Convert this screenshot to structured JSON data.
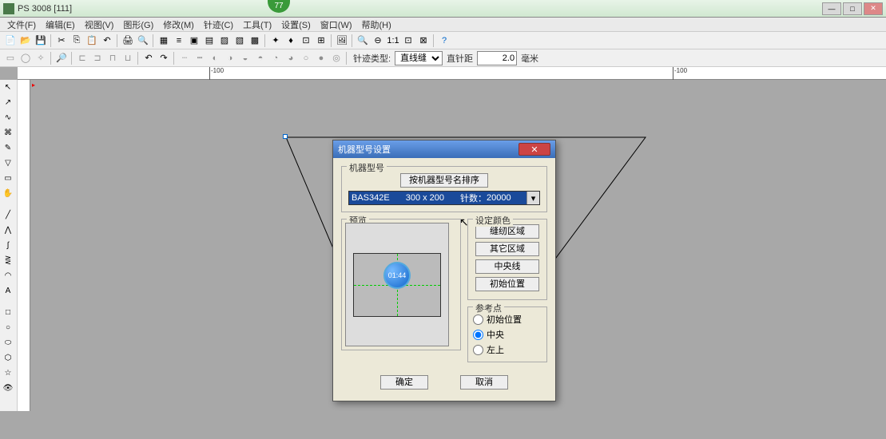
{
  "title": "PS 3008  [111]",
  "badge": "77",
  "menu": [
    "文件(F)",
    "编辑(E)",
    "视图(V)",
    "图形(G)",
    "修改(M)",
    "针迹(C)",
    "工具(T)",
    "设置(S)",
    "窗口(W)",
    "帮助(H)"
  ],
  "toolbar2": {
    "stitch_type_label": "针迹类型:",
    "stitch_type_value": "直线缝",
    "pitch_label": "直针距",
    "pitch_value": "2.0",
    "unit": "毫米"
  },
  "ruler": {
    "n100a": "-100",
    "n100b": "-100"
  },
  "dialog": {
    "title": "机器型号设置",
    "group_model": "机器型号",
    "sort_btn": "按机器型号名排序",
    "combo_model": "BAS342E",
    "combo_size": "300 x 200",
    "combo_stitch_label": "针数：",
    "combo_stitch": "20000",
    "preview_label": "预览",
    "circle_text": "01:44",
    "colors_label": "设定颜色",
    "btn_sew_area": "缝纫区域",
    "btn_other_area": "其它区域",
    "btn_center": "中央线",
    "btn_init_pos": "初始位置",
    "ref_label": "参考点",
    "radio_init": "初始位置",
    "radio_center": "中央",
    "radio_topleft": "左上",
    "ok": "确定",
    "cancel": "取消"
  }
}
